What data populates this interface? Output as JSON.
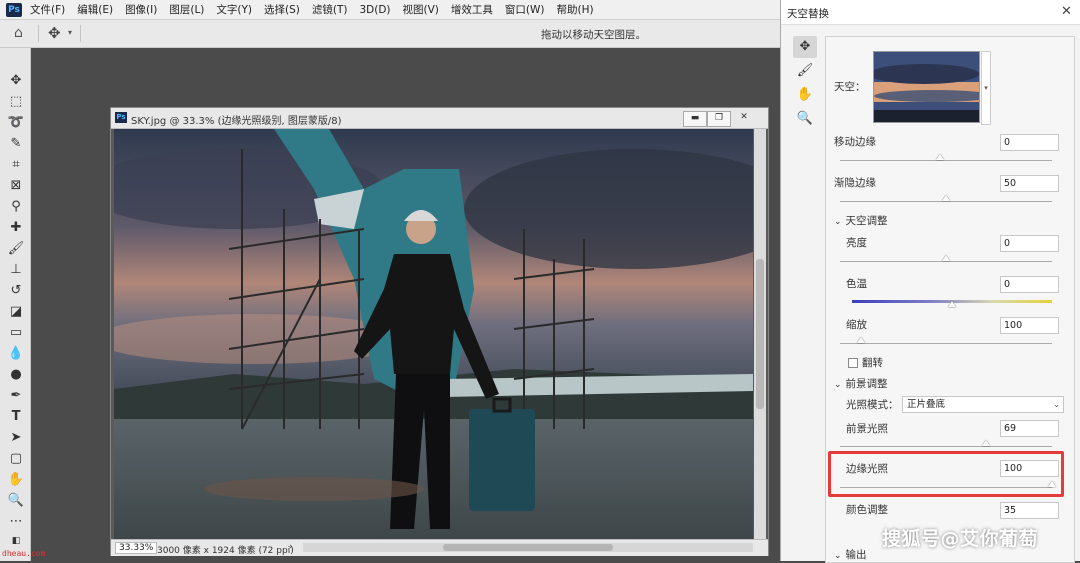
{
  "menubar": {
    "logo": "Ps",
    "items": [
      "文件(F)",
      "编辑(E)",
      "图像(I)",
      "图层(L)",
      "文字(Y)",
      "选择(S)",
      "滤镜(T)",
      "3D(D)",
      "视图(V)",
      "增效工具",
      "窗口(W)",
      "帮助(H)"
    ]
  },
  "optbar": {
    "hint": "拖动以移动天空图层。"
  },
  "document": {
    "logo": "Ps",
    "title": "SKY.jpg @ 33.3% (边缘光照级别, 图层蒙版/8)",
    "minimize": "▬",
    "restore": "❐",
    "close": "✕",
    "zoom": "33.33%",
    "dimensions": "3000 像素 x 1924 像素 (72 ppi)",
    "status_arrow": "›"
  },
  "panel": {
    "title": "天空替换",
    "close": "✕",
    "sky_label": "天空：",
    "shift_edge": {
      "label": "移动边缘",
      "value": "0",
      "level": 0.47
    },
    "fade_edge": {
      "label": "渐隐边缘",
      "value": "50",
      "level": 0.5
    },
    "sky_adjust": "天空调整",
    "brightness": {
      "label": "亮度",
      "value": "0",
      "level": 0.5
    },
    "temperature": {
      "label": "色温",
      "value": "0",
      "level": 0.5
    },
    "scale": {
      "label": "缩放",
      "value": "100",
      "level": 0.1
    },
    "flip": "翻转",
    "fg_adjust": "前景调整",
    "lighting_mode": {
      "label": "光照模式：",
      "value": "正片叠底"
    },
    "fg_lighting": {
      "label": "前景光照",
      "value": "69",
      "level": 0.69
    },
    "edge_lighting": {
      "label": "边缘光照",
      "value": "100",
      "level": 1.0
    },
    "color_adjust": {
      "label": "颜色调整",
      "value": "35"
    },
    "output": "输出"
  },
  "watermark": {
    "small": "dheau.com",
    "brand": "搜狐号@艾你葡萄"
  },
  "colors": {
    "highlight": "#e53b3b",
    "accent": "#2c2cb0"
  }
}
